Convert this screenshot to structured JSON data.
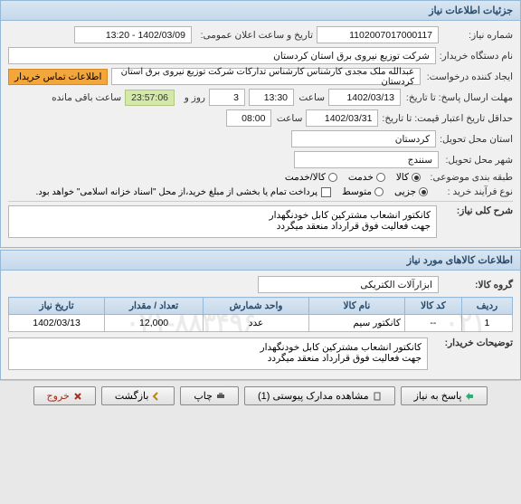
{
  "panel1_title": "جزئیات اطلاعات نیاز",
  "need_number_label": "شماره نیاز:",
  "need_number": "1102007017000117",
  "ann_datetime_label": "تاریخ و ساعت اعلان عمومی:",
  "ann_datetime": "1402/03/09 - 13:20",
  "buyer_org_label": "نام دستگاه خریدار:",
  "buyer_org": "شرکت توزیع نیروی برق استان کردستان",
  "requester_label": "ایجاد کننده درخواست:",
  "requester": "عبدالله ملک مجدی کارشناس کارشناس تدارکات شرکت توزیع نیروی برق استان کردستان",
  "contact_label": "اطلاعات تماس خریدار",
  "reply_deadline_label": "مهلت ارسال پاسخ: تا تاریخ:",
  "reply_date": "1402/03/13",
  "time_label": "ساعت",
  "reply_time": "13:30",
  "days_label": "روز و",
  "days_val": "3",
  "remain_time": "23:57:06",
  "remain_label": "ساعت باقی مانده",
  "valid_label": "حداقل تاریخ اعتبار قیمت: تا تاریخ:",
  "valid_date": "1402/03/31",
  "valid_time": "08:00",
  "province_label": "استان محل تحویل:",
  "province": "کردستان",
  "city_label": "شهر محل تحویل:",
  "city": "سنندج",
  "subject_cat_label": "طبقه بندی موضوعی:",
  "cat_goods": "کالا",
  "cat_service": "خدمت",
  "cat_goods_service": "کالا/خدمت",
  "process_label": "نوع فرآیند خرید :",
  "proc_small": "جزیی",
  "proc_medium": "متوسط",
  "proc_note": "پرداخت تمام یا بخشی از مبلغ خرید،از محل \"اسناد خزانه اسلامی\" خواهد بود.",
  "desc_label": "شرح کلی نیاز:",
  "desc_text": "کانکتور انشعاب مشترکین کابل خودنگهدار\nجهت فعالیت فوق قرارداد منعقد میگردد",
  "panel2_title": "اطلاعات کالاهای مورد نیاز",
  "goods_group_label": "گروه کالا:",
  "goods_group": "ابزارآلات الکتریکی",
  "th_row": "ردیف",
  "th_code": "کد کالا",
  "th_name": "نام کالا",
  "th_unit": "واحد شمارش",
  "th_qty": "تعداد / مقدار",
  "th_need_date": "تاریخ نیاز",
  "td_row": "1",
  "td_code": "--",
  "td_name": "کانکتور سیم",
  "td_unit": "عدد",
  "td_qty": "12,000",
  "td_need_date": "1402/03/13",
  "buyer_notes_label": "توضیحات خریدار:",
  "buyer_notes": "کانکتور انشعاب مشترکین کابل خودنگهدار\nجهت فعالیت فوق قرارداد منعقد میگردد",
  "btn_respond": "پاسخ به نیاز",
  "btn_docs": "مشاهده مدارک پیوستی (1)",
  "btn_print": "چاپ",
  "btn_back": "بازگشت",
  "btn_exit": "خروج",
  "wm1": "۰۲۱-۸۸۳۴۹۶",
  "wm2": "۰۲۱"
}
